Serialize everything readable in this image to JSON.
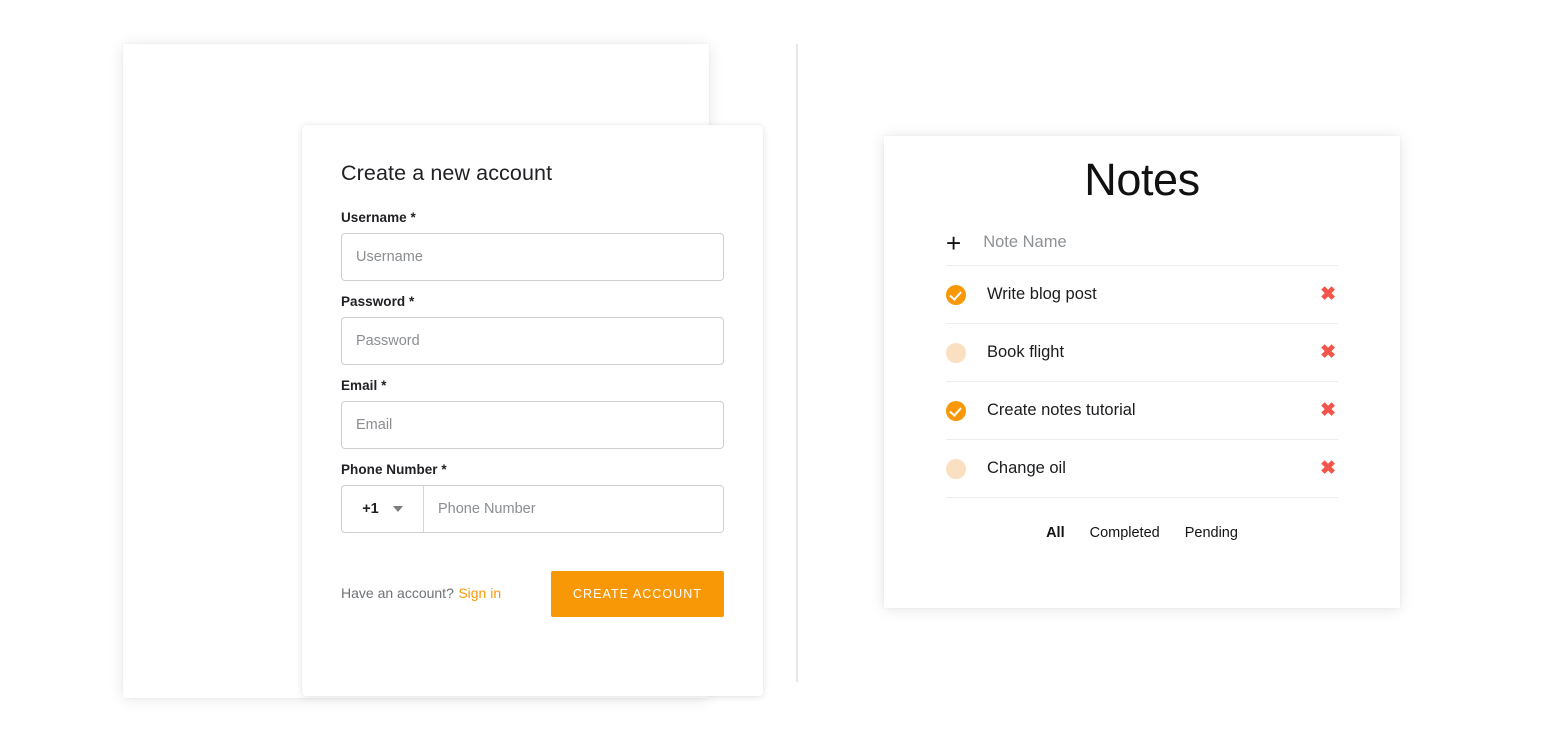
{
  "signup": {
    "title": "Create a new account",
    "fields": [
      {
        "label": "Username *",
        "placeholder": "Username",
        "value": ""
      },
      {
        "label": "Password *",
        "placeholder": "Password",
        "value": ""
      },
      {
        "label": "Email *",
        "placeholder": "Email",
        "value": ""
      }
    ],
    "phone": {
      "label": "Phone Number *",
      "country_code": "+1",
      "placeholder": "Phone Number",
      "value": "",
      "caret_icon": "chevron-down-icon"
    },
    "footer": {
      "account_text": "Have an account?",
      "signin_label": "Sign in",
      "create_button": "CREATE ACCOUNT"
    },
    "colors": {
      "accent": "#f99806",
      "button_text": "#ffffff",
      "border": "#cfcfcf",
      "placeholder": "#8a8d91"
    }
  },
  "notes": {
    "title": "Notes",
    "add": {
      "plus_icon": "plus-icon",
      "placeholder": "Note Name",
      "value": ""
    },
    "items": [
      {
        "text": "Write blog post",
        "done": true,
        "delete_icon": "close-icon"
      },
      {
        "text": "Book flight",
        "done": false,
        "delete_icon": "close-icon"
      },
      {
        "text": "Create notes tutorial",
        "done": true,
        "delete_icon": "close-icon"
      },
      {
        "text": "Change oil",
        "done": false,
        "delete_icon": "close-icon"
      }
    ],
    "filters": [
      {
        "label": "All",
        "active": true
      },
      {
        "label": "Completed",
        "active": false
      },
      {
        "label": "Pending",
        "active": false
      }
    ],
    "colors": {
      "checked": "#f99806",
      "unchecked": "#fbdfc1",
      "delete": "#f4554a"
    }
  }
}
